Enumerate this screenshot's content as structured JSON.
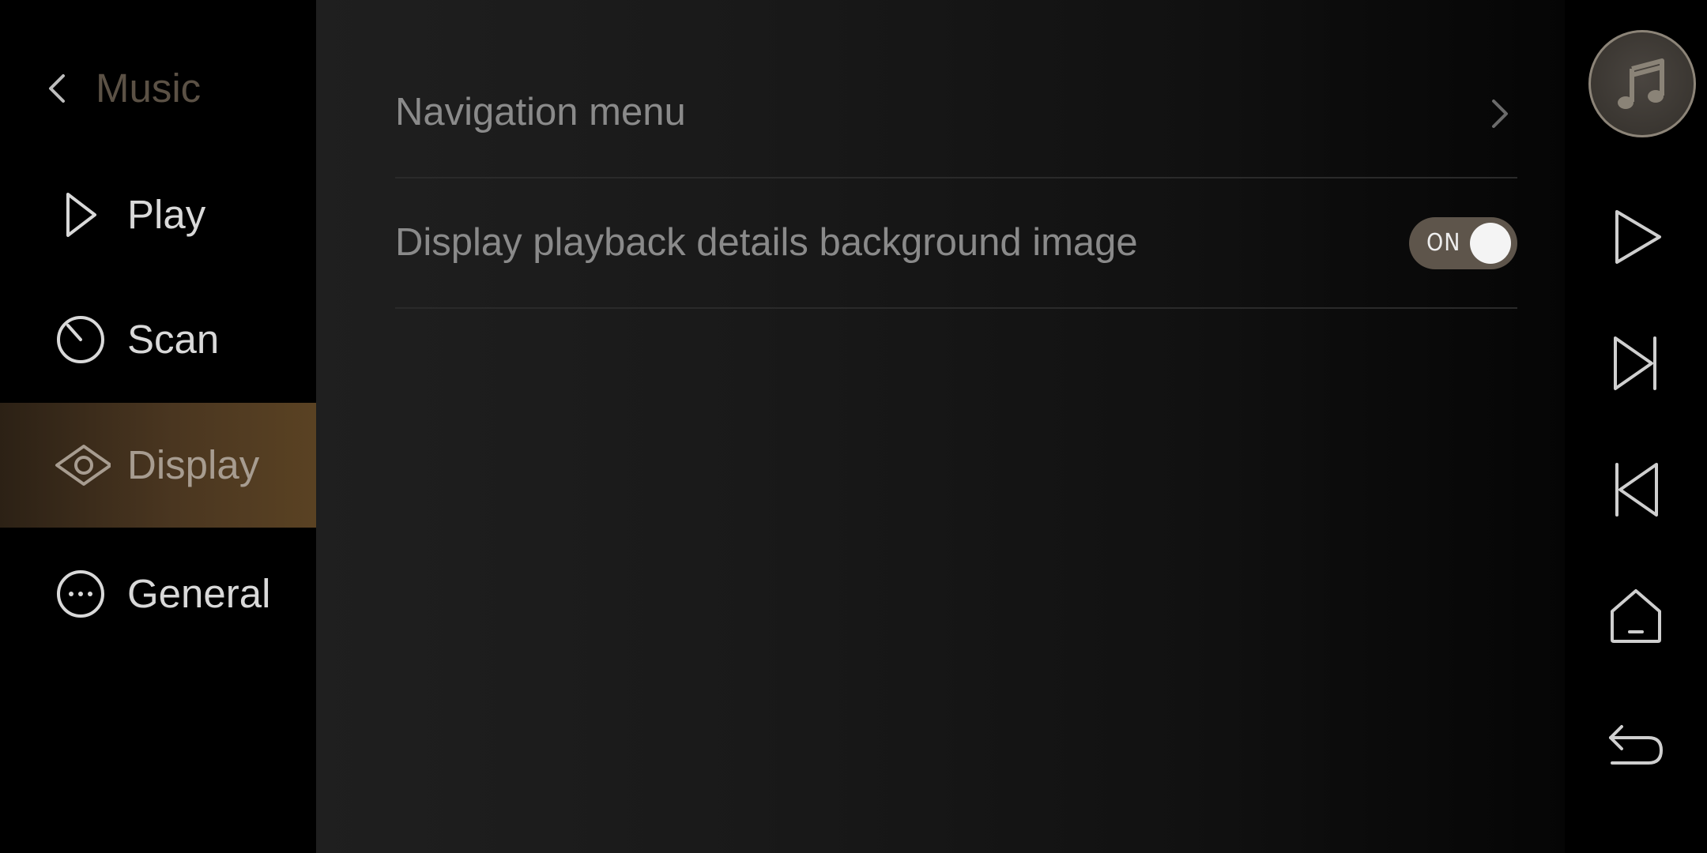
{
  "sidebar": {
    "title": "Music",
    "items": [
      {
        "label": "Play",
        "icon": "play-icon",
        "active": false
      },
      {
        "label": "Scan",
        "icon": "scan-icon",
        "active": false
      },
      {
        "label": "Display",
        "icon": "eye-icon",
        "active": true
      },
      {
        "label": "General",
        "icon": "more-icon",
        "active": false
      }
    ]
  },
  "settings": {
    "rows": [
      {
        "label": "Navigation menu",
        "control": "chevron-right-icon"
      },
      {
        "label": "Display playback details background image",
        "control": "toggle",
        "toggle_text": "ON",
        "toggle_state": true
      }
    ]
  },
  "rail": {
    "icons": [
      "music-note-icon",
      "play-icon",
      "next-track-icon",
      "previous-track-icon",
      "home-icon",
      "back-icon"
    ]
  },
  "colors": {
    "accent": "#5a4223",
    "toggle_on": "#5e554b",
    "label_text": "#8a8a8a",
    "sidebar_title": "#5b5145"
  }
}
